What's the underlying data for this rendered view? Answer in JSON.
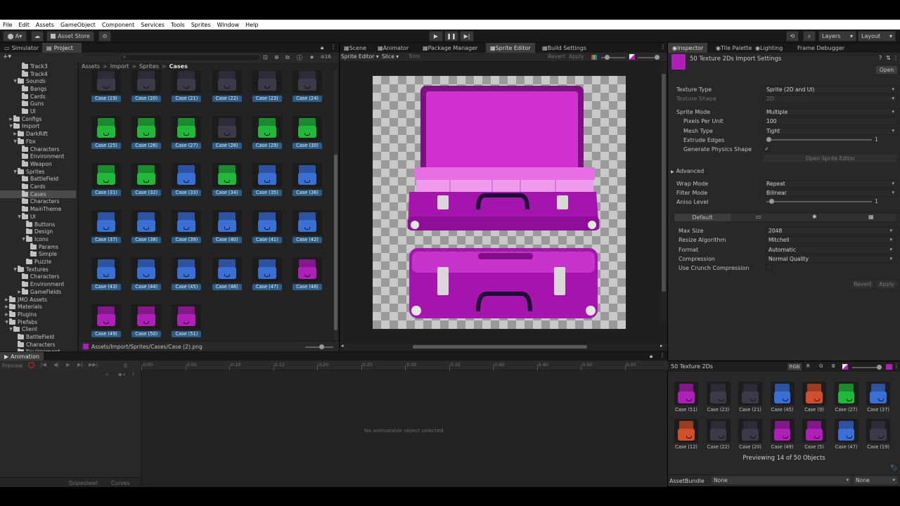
{
  "menu": [
    "File",
    "Edit",
    "Assets",
    "GameObject",
    "Component",
    "Services",
    "Tools",
    "Sprites",
    "Window",
    "Help"
  ],
  "toolbar": {
    "account_label": "A",
    "asset_store_label": "Asset Store",
    "layers_label": "Layers",
    "layout_label": "Layout"
  },
  "left_tabs": [
    "Simulator",
    "Project"
  ],
  "project": {
    "search_placeholder": "",
    "hidden_count": "16",
    "breadcrumb": [
      "Assets",
      "Import",
      "Sprites",
      "Cases"
    ],
    "status_path": "Assets/Import/Sprites/Cases/Case (2).png",
    "tree": [
      {
        "label": "Track3",
        "indent": 4,
        "fold": ""
      },
      {
        "label": "Track4",
        "indent": 4,
        "fold": ""
      },
      {
        "label": "Sounds",
        "indent": 3,
        "fold": "▼"
      },
      {
        "label": "Bangs",
        "indent": 4,
        "fold": ""
      },
      {
        "label": "Cards",
        "indent": 4,
        "fold": ""
      },
      {
        "label": "Guns",
        "indent": 4,
        "fold": ""
      },
      {
        "label": "UI",
        "indent": 4,
        "fold": ""
      },
      {
        "label": "Configs",
        "indent": 2,
        "fold": "▶"
      },
      {
        "label": "Import",
        "indent": 2,
        "fold": "▼"
      },
      {
        "label": "DarkRift",
        "indent": 3,
        "fold": "▶"
      },
      {
        "label": "Fbx",
        "indent": 3,
        "fold": "▼"
      },
      {
        "label": "Characters",
        "indent": 4,
        "fold": ""
      },
      {
        "label": "Environment",
        "indent": 4,
        "fold": ""
      },
      {
        "label": "Weapon",
        "indent": 4,
        "fold": ""
      },
      {
        "label": "Sprites",
        "indent": 3,
        "fold": "▼"
      },
      {
        "label": "BattleField",
        "indent": 4,
        "fold": ""
      },
      {
        "label": "Cards",
        "indent": 4,
        "fold": ""
      },
      {
        "label": "Cases",
        "indent": 4,
        "fold": "",
        "selected": true
      },
      {
        "label": "Characters",
        "indent": 4,
        "fold": ""
      },
      {
        "label": "MainTheme",
        "indent": 4,
        "fold": ""
      },
      {
        "label": "UI",
        "indent": 4,
        "fold": "▼"
      },
      {
        "label": "Buttons",
        "indent": 5,
        "fold": ""
      },
      {
        "label": "Design",
        "indent": 5,
        "fold": ""
      },
      {
        "label": "Icons",
        "indent": 5,
        "fold": "▼"
      },
      {
        "label": "Params",
        "indent": 6,
        "fold": ""
      },
      {
        "label": "Simple",
        "indent": 6,
        "fold": ""
      },
      {
        "label": "Puzzle",
        "indent": 5,
        "fold": ""
      },
      {
        "label": "Textures",
        "indent": 3,
        "fold": "▼"
      },
      {
        "label": "Characters",
        "indent": 4,
        "fold": ""
      },
      {
        "label": "Environment",
        "indent": 4,
        "fold": ""
      },
      {
        "label": "GameFields",
        "indent": 4,
        "fold": "▶"
      },
      {
        "label": "JMO Assets",
        "indent": 1,
        "fold": "▶"
      },
      {
        "label": "Materials",
        "indent": 1,
        "fold": "▶"
      },
      {
        "label": "Plugins",
        "indent": 1,
        "fold": "▶"
      },
      {
        "label": "Prefabs",
        "indent": 1,
        "fold": "▼"
      },
      {
        "label": "Client",
        "indent": 2,
        "fold": "▼"
      },
      {
        "label": "BattleField",
        "indent": 3,
        "fold": ""
      },
      {
        "label": "Characters",
        "indent": 3,
        "fold": ""
      },
      {
        "label": "Environment",
        "indent": 3,
        "fold": ""
      }
    ],
    "assets": [
      {
        "label": "Case (19)",
        "color": "dark"
      },
      {
        "label": "Case (20)",
        "color": "dark"
      },
      {
        "label": "Case (21)",
        "color": "dark"
      },
      {
        "label": "Case (22)",
        "color": "dark"
      },
      {
        "label": "Case (23)",
        "color": "dark"
      },
      {
        "label": "Case (24)",
        "color": "dark"
      },
      {
        "label": "Case (25)",
        "color": "green"
      },
      {
        "label": "Case (26)",
        "color": "green"
      },
      {
        "label": "Case (27)",
        "color": "green"
      },
      {
        "label": "Case (28)",
        "color": "dark"
      },
      {
        "label": "Case (29)",
        "color": "green"
      },
      {
        "label": "Case (30)",
        "color": "green"
      },
      {
        "label": "Case (31)",
        "color": "green"
      },
      {
        "label": "Case (32)",
        "color": "green"
      },
      {
        "label": "Case (33)",
        "color": "blue"
      },
      {
        "label": "Case (34)",
        "color": "green"
      },
      {
        "label": "Case (35)",
        "color": "blue"
      },
      {
        "label": "Case (36)",
        "color": "blue"
      },
      {
        "label": "Case (37)",
        "color": "blue"
      },
      {
        "label": "Case (38)",
        "color": "blue"
      },
      {
        "label": "Case (39)",
        "color": "blue"
      },
      {
        "label": "Case (40)",
        "color": "blue"
      },
      {
        "label": "Case (41)",
        "color": "blue"
      },
      {
        "label": "Case (42)",
        "color": "blue"
      },
      {
        "label": "Case (43)",
        "color": "blue"
      },
      {
        "label": "Case (44)",
        "color": "blue"
      },
      {
        "label": "Case (45)",
        "color": "blue"
      },
      {
        "label": "Case (46)",
        "color": "blue"
      },
      {
        "label": "Case (47)",
        "color": "blue"
      },
      {
        "label": "Case (48)",
        "color": "magenta"
      },
      {
        "label": "Case (49)",
        "color": "magenta"
      },
      {
        "label": "Case (50)",
        "color": "magenta"
      },
      {
        "label": "Case (51)",
        "color": "magenta"
      }
    ]
  },
  "center_tabs": [
    "Scene",
    "Animator",
    "Package Manager",
    "Sprite Editor",
    "Build Settings"
  ],
  "sprite_editor": {
    "dropdown": "Sprite Editor",
    "slice": "Slice",
    "trim": "Trim",
    "revert": "Revert",
    "apply": "Apply"
  },
  "right_tabs": [
    "Inspector",
    "Tile Palette",
    "Lighting",
    "Frame Debugger"
  ],
  "inspector": {
    "title": "50 Texture 2Ds Import Settings",
    "open_label": "Open",
    "rows": {
      "texture_type": {
        "label": "Texture Type",
        "value": "Sprite (2D and UI)"
      },
      "texture_shape": {
        "label": "Texture Shape",
        "value": "2D"
      },
      "sprite_mode": {
        "label": "Sprite Mode",
        "value": "Multiple"
      },
      "ppu": {
        "label": "Pixels Per Unit",
        "value": "100"
      },
      "mesh_type": {
        "label": "Mesh Type",
        "value": "Tight"
      },
      "extrude": {
        "label": "Extrude Edges",
        "value": "1"
      },
      "physics": {
        "label": "Generate Physics Shape"
      },
      "open_sprite_editor": "Open Sprite Editor",
      "advanced": "Advanced",
      "wrap_mode": {
        "label": "Wrap Mode",
        "value": "Repeat"
      },
      "filter_mode": {
        "label": "Filter Mode",
        "value": "Bilinear"
      },
      "aniso": {
        "label": "Aniso Level",
        "value": "1"
      },
      "platform_default": "Default",
      "max_size": {
        "label": "Max Size",
        "value": "2048"
      },
      "resize": {
        "label": "Resize Algorithm",
        "value": "Mitchell"
      },
      "format": {
        "label": "Format",
        "value": "Automatic"
      },
      "compression": {
        "label": "Compression",
        "value": "Normal Quality"
      },
      "crunch": {
        "label": "Use Crunch Compression"
      }
    },
    "revert": "Revert",
    "apply": "Apply"
  },
  "preview": {
    "title": "50 Texture 2Ds",
    "channels": [
      "RGB",
      "R",
      "G",
      "B"
    ],
    "tiles": [
      {
        "label": "Case (51)",
        "color": "magenta"
      },
      {
        "label": "Case (23)",
        "color": "dark"
      },
      {
        "label": "Case (21)",
        "color": "dark"
      },
      {
        "label": "Case (45)",
        "color": "blue"
      },
      {
        "label": "Case (9)",
        "color": "orange"
      },
      {
        "label": "Case (27)",
        "color": "green"
      },
      {
        "label": "Case (37)",
        "color": "blue"
      },
      {
        "label": "Case (12)",
        "color": "orange"
      },
      {
        "label": "Case (22)",
        "color": "dark"
      },
      {
        "label": "Case (20)",
        "color": "dark"
      },
      {
        "label": "Case (49)",
        "color": "magenta"
      },
      {
        "label": "Case (5)",
        "color": "magenta"
      },
      {
        "label": "Case (47)",
        "color": "blue"
      },
      {
        "label": "Case (19)",
        "color": "dark"
      }
    ],
    "status": "Previewing 14 of 50 Objects"
  },
  "assetbundle": {
    "label": "AssetBundle",
    "value": "None",
    "variant": "None"
  },
  "animation": {
    "tab": "Animation",
    "preview_label": "Preview",
    "frame": "0",
    "ruler": [
      "0:00",
      "0:05",
      "0:10",
      "0:15",
      "0:20",
      "0:25",
      "0:30",
      "0:35",
      "0:40",
      "0:45",
      "0:50",
      "0:55"
    ],
    "empty_msg": "No animatable object selected.",
    "dopesheet": "Dopesheet",
    "curves": "Curves"
  },
  "colors": {
    "magenta": "#b01fb8",
    "green": "#22b93a",
    "blue": "#3a6fd6",
    "dark": "#3c3a48",
    "orange": "#d0502c",
    "selection": "#2c5d87"
  }
}
